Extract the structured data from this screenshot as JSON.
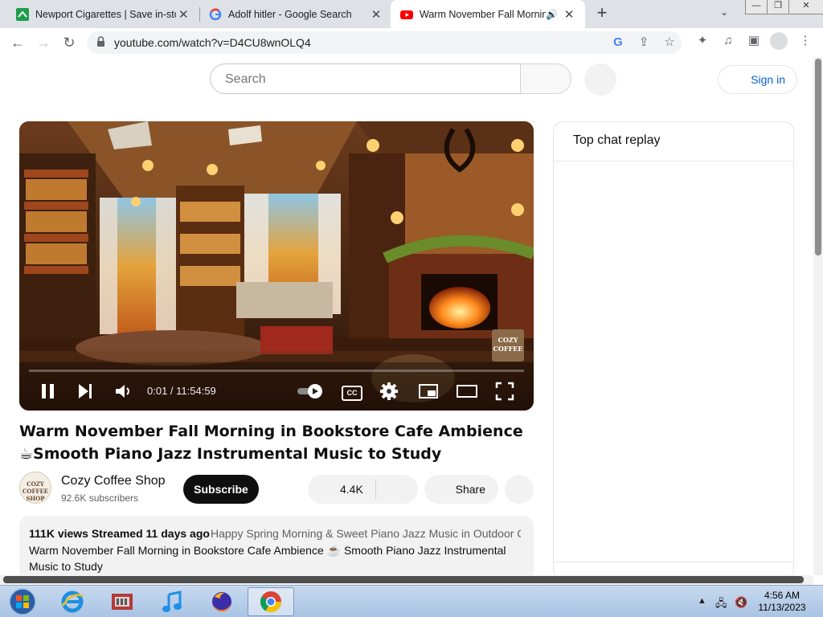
{
  "browser": {
    "tabs": [
      {
        "title": "Newport Cigarettes | Save in-sto",
        "favicon": "newport-favicon",
        "active": false
      },
      {
        "title": "Adolf hitler - Google Search",
        "favicon": "google-favicon",
        "active": false
      },
      {
        "title": "Warm November Fall Mornin",
        "favicon": "youtube-favicon",
        "active": true,
        "audio": true
      }
    ],
    "new_tab": "+",
    "window_buttons": {
      "minimize": "—",
      "maximize": "❐",
      "close": "✕"
    },
    "url": "youtube.com/watch?v=D4CU8wnOLQ4"
  },
  "youtube": {
    "search_placeholder": "Search",
    "sign_in": "Sign in",
    "player": {
      "time": "0:01 / 11:54:59",
      "cc": "CC",
      "watermark": [
        "COZY",
        "COFFEE"
      ],
      "progress": 0.0
    },
    "video_title": "Warm November Fall Morning in Bookstore Cafe Ambience ☕Smooth Piano Jazz Instrumental Music to Study",
    "channel": {
      "name": "Cozy Coffee Shop",
      "subscribers": "92.6K subscribers",
      "avatar_text": [
        "COZY",
        "COFFEE",
        "SHOP"
      ]
    },
    "subscribe": "Subscribe",
    "likes": "4.4K",
    "share": "Share",
    "description": {
      "meta": "111K views  Streamed 11 days ago",
      "tags": "Happy Spring Morning & Sweet Piano Jazz Music in Outdoor C",
      "text": "Warm November Fall Morning in Bookstore Cafe Ambience ☕ Smooth Piano Jazz Instrumental Music to Study"
    },
    "chat_title": "Top chat replay"
  },
  "taskbar": {
    "time": "4:56 AM",
    "date": "11/13/2023",
    "apps": [
      "start-orb",
      "internet-explorer",
      "media-center",
      "itunes",
      "firefox",
      "chrome"
    ]
  },
  "colors": {
    "accent_link": "#065fd4",
    "youtube_red": "#ff0000",
    "chrome_tabstrip": "#dee1e6"
  }
}
